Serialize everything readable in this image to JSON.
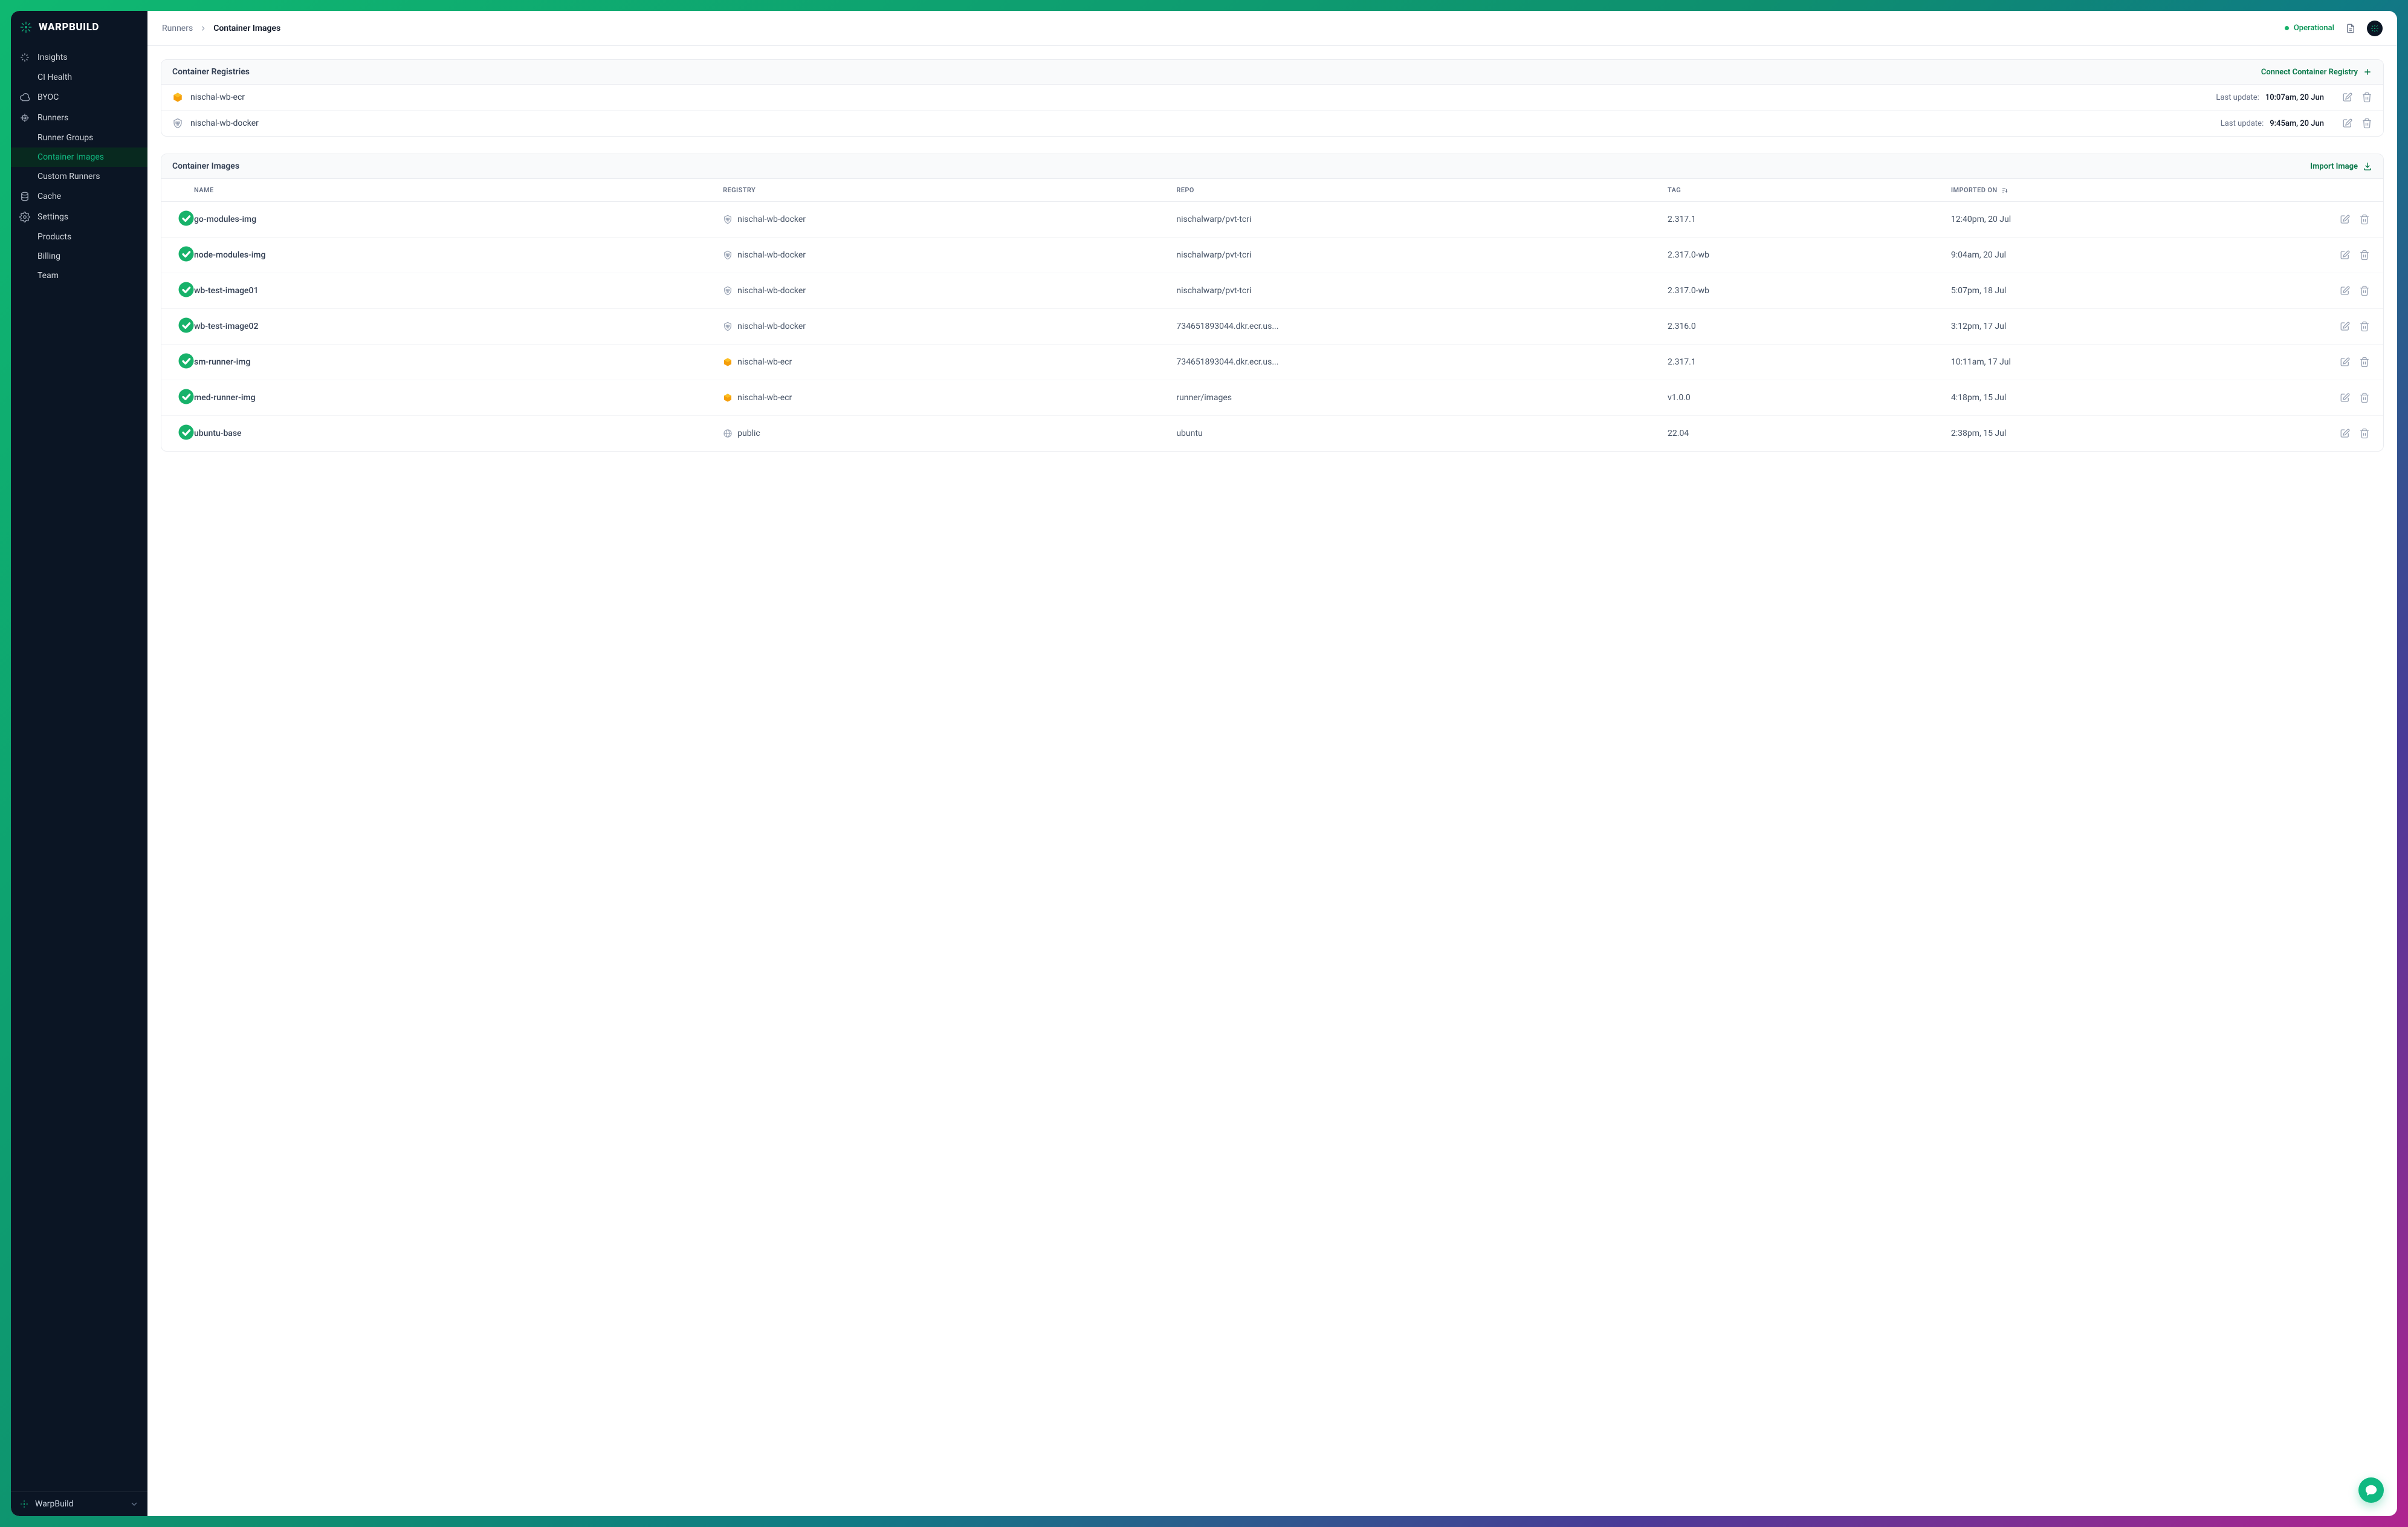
{
  "brand": {
    "name": "WARPBUILD",
    "org": "WarpBuild"
  },
  "nav": {
    "insights": "Insights",
    "ci_health": "CI Health",
    "byoc": "BYOC",
    "runners": "Runners",
    "runner_groups": "Runner Groups",
    "container_images": "Container Images",
    "custom_runners": "Custom Runners",
    "cache": "Cache",
    "settings": "Settings",
    "products": "Products",
    "billing": "Billing",
    "team": "Team"
  },
  "breadcrumb": {
    "parent": "Runners",
    "current": "Container Images"
  },
  "status": {
    "label": "Operational"
  },
  "registries": {
    "title": "Container Registries",
    "connect_label": "Connect Container Registry",
    "last_update_label": "Last update:",
    "items": [
      {
        "name": "nischal-wb-ecr",
        "provider": "ecr",
        "updated": "10:07am, 20 Jun"
      },
      {
        "name": "nischal-wb-docker",
        "provider": "docker",
        "updated": "9:45am, 20 Jun"
      }
    ]
  },
  "images": {
    "title": "Container Images",
    "import_label": "Import Image",
    "columns": {
      "name": "NAME",
      "registry": "REGISTRY",
      "repo": "REPO",
      "tag": "TAG",
      "imported": "IMPORTED ON"
    },
    "rows": [
      {
        "status": "ok",
        "name": "go-modules-img",
        "registry": "nischal-wb-docker",
        "provider": "docker",
        "repo": "nischalwarp/pvt-tcri",
        "tag": "2.317.1",
        "imported": "12:40pm, 20 Jul"
      },
      {
        "status": "ok",
        "name": "node-modules-img",
        "registry": "nischal-wb-docker",
        "provider": "docker",
        "repo": "nischalwarp/pvt-tcri",
        "tag": "2.317.0-wb",
        "imported": "9:04am, 20 Jul"
      },
      {
        "status": "ok",
        "name": "wb-test-image01",
        "registry": "nischal-wb-docker",
        "provider": "docker",
        "repo": "nischalwarp/pvt-tcri",
        "tag": "2.317.0-wb",
        "imported": "5:07pm, 18 Jul"
      },
      {
        "status": "ok",
        "name": "wb-test-image02",
        "registry": "nischal-wb-docker",
        "provider": "docker",
        "repo": "734651893044.dkr.ecr.us...",
        "tag": "2.316.0",
        "imported": "3:12pm, 17 Jul"
      },
      {
        "status": "ok",
        "name": "sm-runner-img",
        "registry": "nischal-wb-ecr",
        "provider": "ecr",
        "repo": "734651893044.dkr.ecr.us...",
        "tag": "2.317.1",
        "imported": "10:11am, 17 Jul"
      },
      {
        "status": "ok",
        "name": "med-runner-img",
        "registry": "nischal-wb-ecr",
        "provider": "ecr",
        "repo": "runner/images",
        "tag": "v1.0.0",
        "imported": "4:18pm, 15 Jul"
      },
      {
        "status": "ok",
        "name": "ubuntu-base",
        "registry": "public",
        "provider": "public",
        "repo": "ubuntu",
        "tag": "22.04",
        "imported": "2:38pm, 15 Jul"
      }
    ]
  }
}
